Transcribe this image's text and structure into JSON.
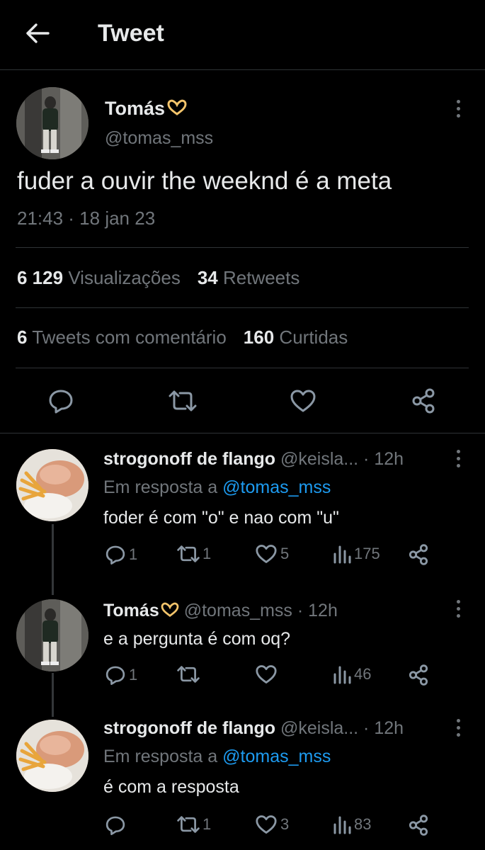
{
  "header": {
    "title": "Tweet",
    "back_icon": "arrow-left-icon"
  },
  "main_tweet": {
    "author_name": "Tomás",
    "author_emoji": "heart-hands-icon",
    "handle": "@tomas_mss",
    "text": "fuder a ouvir the weeknd é a meta",
    "timestamp": "21:43 · 18 jan 23",
    "stats": {
      "views_count": "6 129",
      "views_label": "Visualizações",
      "retweets_count": "34",
      "retweets_label": "Retweets",
      "quotes_count": "6",
      "quotes_label": "Tweets com comentário",
      "likes_count": "160",
      "likes_label": "Curtidas"
    }
  },
  "replies": [
    {
      "author_name": "strogonoff de flango",
      "handle_time": "@keisla... · 12h",
      "reply_prefix": "Em resposta a",
      "reply_to": "@tomas_mss",
      "text": "foder é com \"o\" e nao com \"u\"",
      "replies": "1",
      "retweets": "1",
      "likes": "5",
      "views": "175"
    },
    {
      "author_name": "Tomás",
      "handle_time": "@tomas_mss · 12h",
      "text": "e a pergunta é com oq?",
      "replies": "1",
      "retweets": "",
      "likes": "",
      "views": "46"
    },
    {
      "author_name": "strogonoff de flango",
      "handle_time": "@keisla... · 12h",
      "reply_prefix": "Em resposta a",
      "reply_to": "@tomas_mss",
      "text": "é com a resposta",
      "replies": "",
      "retweets": "1",
      "likes": "3",
      "views": "83"
    }
  ],
  "colors": {
    "background": "#000000",
    "text": "#e7e9ea",
    "muted": "#71767b",
    "link": "#1d9bf0",
    "divider": "#2f3336"
  }
}
